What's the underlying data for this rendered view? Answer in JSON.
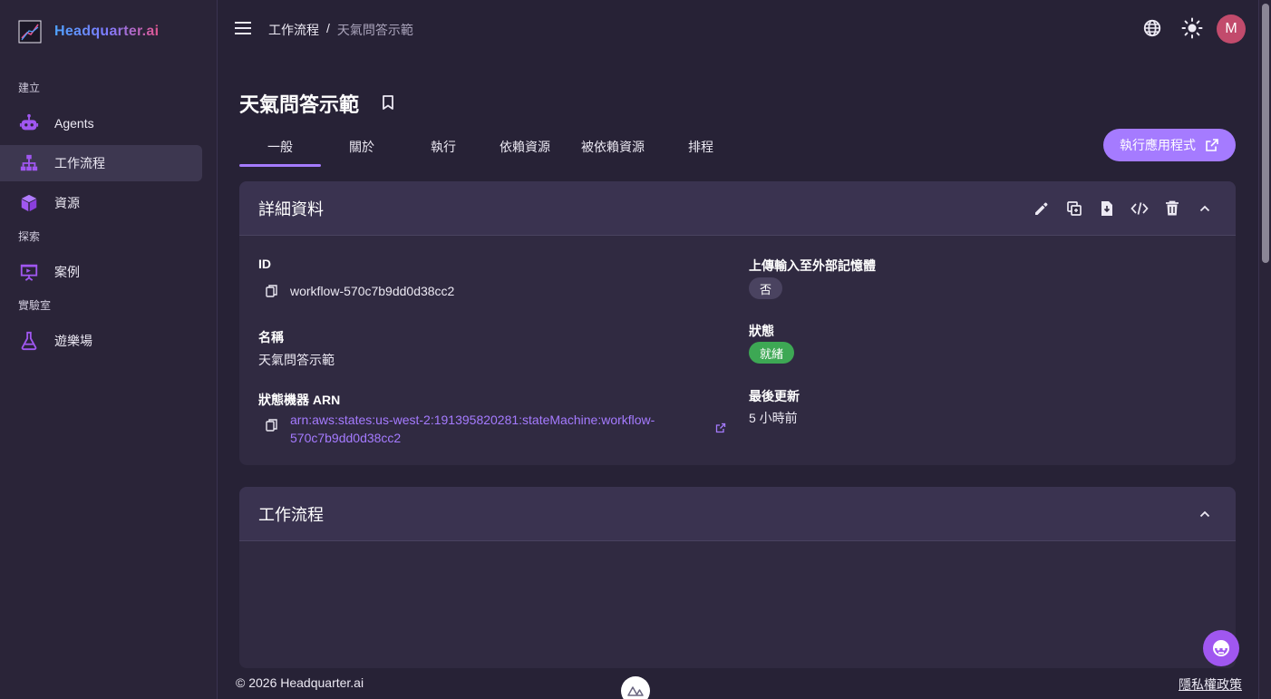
{
  "app": {
    "brand": "Headquarter.ai"
  },
  "sidebar": {
    "sections": [
      {
        "label": "建立"
      },
      {
        "label": "探索"
      },
      {
        "label": "實驗室"
      }
    ],
    "items": [
      {
        "label": "Agents",
        "icon": "robot-icon"
      },
      {
        "label": "工作流程",
        "icon": "sitemap-icon"
      },
      {
        "label": "資源",
        "icon": "cube-icon"
      },
      {
        "label": "案例",
        "icon": "presentation-icon"
      },
      {
        "label": "遊樂場",
        "icon": "flask-icon"
      }
    ],
    "active_index": 1
  },
  "topbar": {
    "breadcrumb": {
      "parent": "工作流程",
      "separator": "/",
      "current": "天氣問答示範"
    },
    "avatar_initial": "M"
  },
  "page": {
    "title": "天氣問答示範",
    "tabs": [
      "一般",
      "關於",
      "執行",
      "依賴資源",
      "被依賴資源",
      "排程"
    ],
    "active_tab": 0,
    "run_button": "執行應用程式"
  },
  "details": {
    "title": "詳細資料",
    "id_label": "ID",
    "id_value": "workflow-570c7b9dd0d38cc2",
    "name_label": "名稱",
    "name_value": "天氣問答示範",
    "arn_label": "狀態機器 ARN",
    "arn_line1": "arn:aws:states:us-west-2:191395820281:stateMachine:workflow-",
    "arn_line2": "570c7b9dd0d38cc2",
    "upload_label": "上傳輸入至外部記憶體",
    "upload_value": "否",
    "status_label": "狀態",
    "status_value": "就緒",
    "updated_label": "最後更新",
    "updated_value": "5 小時前"
  },
  "workflow_card": {
    "title": "工作流程"
  },
  "footer": {
    "copyright": "© 2026 Headquarter.ai",
    "privacy": "隱私權政策"
  },
  "colors": {
    "accent": "#A57BFF",
    "ready": "#3DA854",
    "avatar": "#C24B6C"
  }
}
